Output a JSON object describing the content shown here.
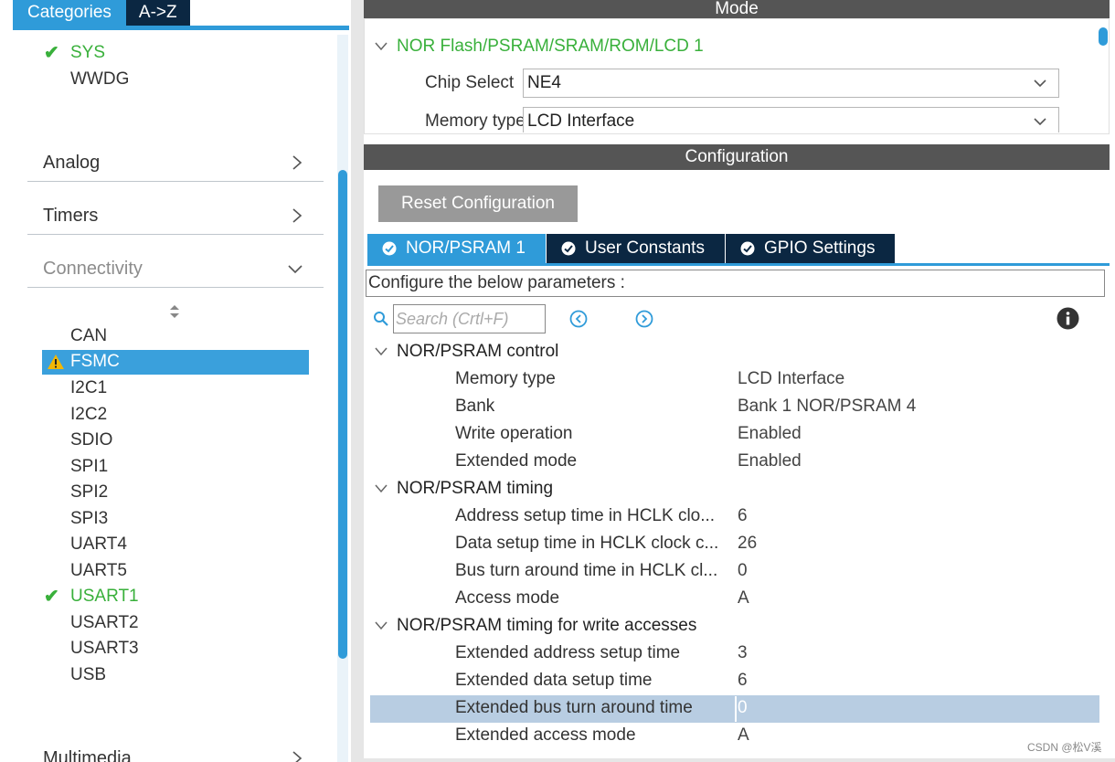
{
  "left_panel": {
    "tabs": {
      "categories": "Categories",
      "az": "A->Z"
    },
    "system_items": [
      {
        "label": "SYS",
        "status": "ok"
      },
      {
        "label": "WWDG",
        "status": "none"
      }
    ],
    "groups": {
      "analog": "Analog",
      "timers": "Timers",
      "connectivity": "Connectivity",
      "multimedia": "Multimedia"
    },
    "connectivity_items": [
      {
        "label": "CAN",
        "status": "none"
      },
      {
        "label": "FSMC",
        "status": "warning",
        "selected": true
      },
      {
        "label": "I2C1",
        "status": "none"
      },
      {
        "label": "I2C2",
        "status": "none"
      },
      {
        "label": "SDIO",
        "status": "none"
      },
      {
        "label": "SPI1",
        "status": "none"
      },
      {
        "label": "SPI2",
        "status": "none"
      },
      {
        "label": "SPI3",
        "status": "none"
      },
      {
        "label": "UART4",
        "status": "none"
      },
      {
        "label": "UART5",
        "status": "none"
      },
      {
        "label": "USART1",
        "status": "ok"
      },
      {
        "label": "USART2",
        "status": "none"
      },
      {
        "label": "USART3",
        "status": "none"
      },
      {
        "label": "USB",
        "status": "none"
      }
    ]
  },
  "mode_panel": {
    "header": "Mode",
    "section_title": "NOR Flash/PSRAM/SRAM/ROM/LCD 1",
    "chip_select_label": "Chip Select",
    "chip_select_value": "NE4",
    "memory_type_label": "Memory type",
    "memory_type_value": "LCD Interface"
  },
  "config_panel": {
    "header": "Configuration",
    "reset_button": "Reset Configuration",
    "tabs": [
      {
        "label": "NOR/PSRAM 1",
        "active": true
      },
      {
        "label": "User Constants",
        "active": false
      },
      {
        "label": "GPIO Settings",
        "active": false
      }
    ],
    "configure_text": "Configure the below parameters :",
    "search_placeholder": "Search (Crtl+F)",
    "sections": {
      "control": {
        "title": "NOR/PSRAM control",
        "params": [
          {
            "name": "Memory type",
            "value": "LCD Interface"
          },
          {
            "name": "Bank",
            "value": "Bank 1 NOR/PSRAM 4"
          },
          {
            "name": "Write operation",
            "value": "Enabled"
          },
          {
            "name": "Extended mode",
            "value": "Enabled"
          }
        ]
      },
      "timing": {
        "title": "NOR/PSRAM timing",
        "params": [
          {
            "name": "Address setup time in HCLK clo...",
            "value": "6"
          },
          {
            "name": "Data setup time in HCLK clock c...",
            "value": "26"
          },
          {
            "name": "Bus turn around time in HCLK cl...",
            "value": "0"
          },
          {
            "name": "Access mode",
            "value": "A"
          }
        ]
      },
      "write": {
        "title": "NOR/PSRAM timing for write accesses",
        "params": [
          {
            "name": "Extended address setup time",
            "value": "3"
          },
          {
            "name": "Extended data setup time",
            "value": "6"
          },
          {
            "name": "Extended bus turn around time",
            "value": "0",
            "selected": true
          },
          {
            "name": "Extended access mode",
            "value": "A"
          }
        ]
      }
    }
  },
  "watermark": "CSDN @松V溪",
  "colors": {
    "accent_blue": "#2f9bd9",
    "dark_navy": "#0b2742",
    "ok_green": "#39b03b",
    "warning_yellow": "#f2b705",
    "header_gray": "#555555"
  }
}
